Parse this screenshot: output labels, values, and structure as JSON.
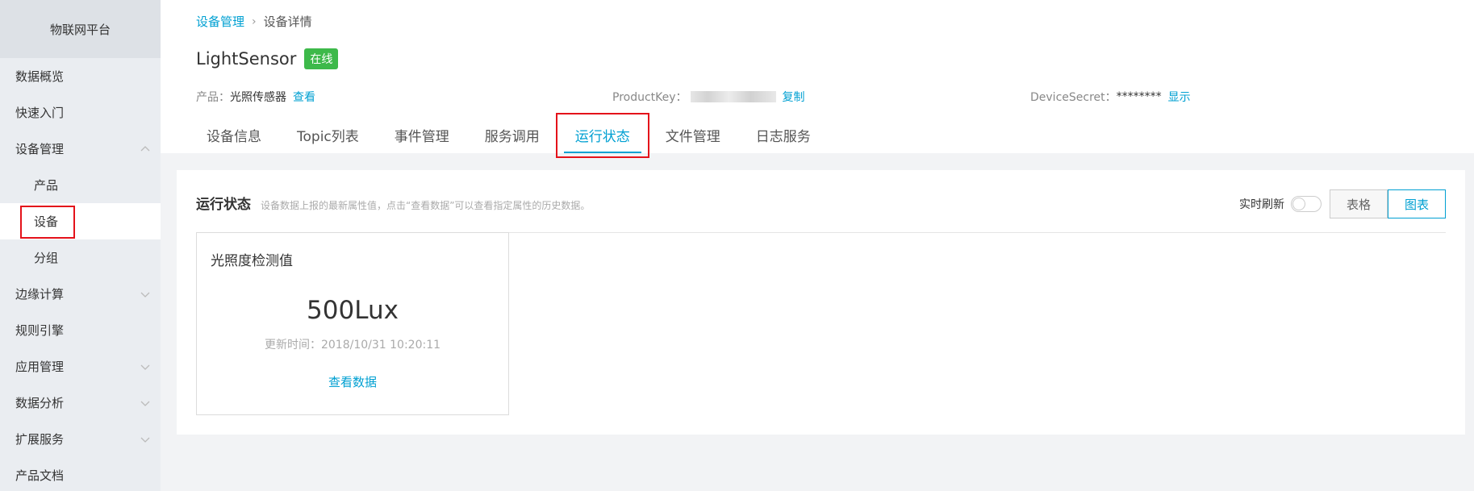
{
  "sidebar": {
    "title": "物联网平台",
    "items": [
      {
        "label": "数据概览"
      },
      {
        "label": "快速入门"
      },
      {
        "label": "设备管理"
      },
      {
        "label": "产品"
      },
      {
        "label": "设备"
      },
      {
        "label": "分组"
      },
      {
        "label": "边缘计算"
      },
      {
        "label": "规则引擎"
      },
      {
        "label": "应用管理"
      },
      {
        "label": "数据分析"
      },
      {
        "label": "扩展服务"
      },
      {
        "label": "产品文档"
      }
    ]
  },
  "breadcrumb": {
    "parent": "设备管理",
    "separator": "›",
    "current": "设备详情"
  },
  "device": {
    "name": "LightSensor",
    "status": "在线",
    "product_label": "产品：",
    "product_value": "光照传感器",
    "product_action": "查看",
    "productkey_label": "ProductKey：",
    "productkey_action": "复制",
    "secret_label": "DeviceSecret：",
    "secret_value": "********",
    "secret_action": "显示"
  },
  "tabs": [
    {
      "label": "设备信息"
    },
    {
      "label": "Topic列表"
    },
    {
      "label": "事件管理"
    },
    {
      "label": "服务调用"
    },
    {
      "label": "运行状态"
    },
    {
      "label": "文件管理"
    },
    {
      "label": "日志服务"
    }
  ],
  "runtime": {
    "title": "运行状态",
    "description": "设备数据上报的最新属性值，点击“查看数据”可以查看指定属性的历史数据。",
    "refresh_label": "实时刷新",
    "view_table": "表格",
    "view_chart": "图表"
  },
  "property": {
    "name": "光照度检测值",
    "value": "500Lux",
    "updated": "更新时间：2018/10/31 10:20:11",
    "action": "查看数据"
  },
  "colors": {
    "accent": "#00a0d2",
    "online": "#3db94a",
    "highlight": "#e4121a"
  }
}
